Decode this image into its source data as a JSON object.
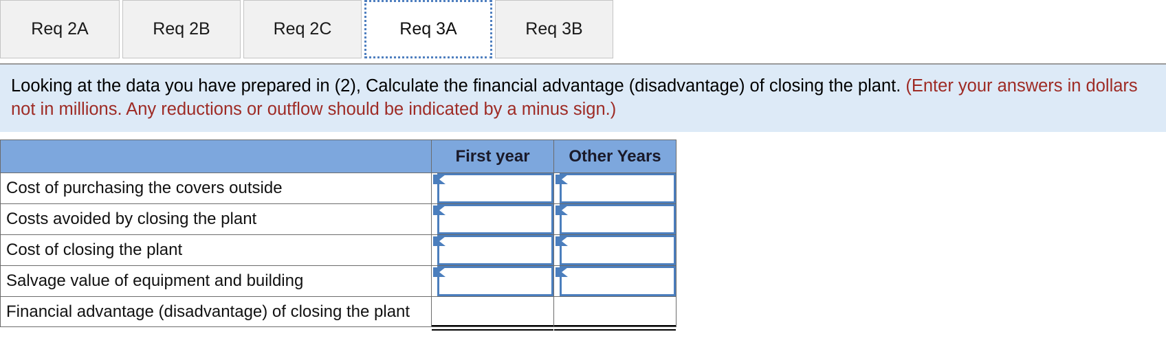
{
  "tabs": [
    {
      "label": "Req 2A",
      "active": false
    },
    {
      "label": "Req 2B",
      "active": false
    },
    {
      "label": "Req 2C",
      "active": false
    },
    {
      "label": "Req 3A",
      "active": true
    },
    {
      "label": "Req 3B",
      "active": false
    }
  ],
  "instructions": {
    "main": "Looking at the data you have prepared in (2), Calculate the financial advantage (disadvantage) of closing the plant.",
    "note": "(Enter your answers in dollars not in millions. Any reductions or outflow should be indicated by a minus sign.)"
  },
  "table": {
    "headers": {
      "label": "",
      "first_year": "First year",
      "other_years": "Other Years"
    },
    "rows": [
      {
        "label": "Cost of purchasing the covers outside",
        "first_year": "",
        "other_years": "",
        "type": "input"
      },
      {
        "label": "Costs avoided by closing the plant",
        "first_year": "",
        "other_years": "",
        "type": "input"
      },
      {
        "label": "Cost of closing the plant",
        "first_year": "",
        "other_years": "",
        "type": "input"
      },
      {
        "label": "Salvage value of equipment and building",
        "first_year": "",
        "other_years": "",
        "type": "input"
      },
      {
        "label": "Financial advantage (disadvantage) of closing the plant",
        "first_year": "",
        "other_years": "",
        "type": "total"
      }
    ]
  },
  "colors": {
    "header_blue": "#7da7dd",
    "panel_blue": "#ddeaf7",
    "note_red": "#9e2b25",
    "input_border": "#4b7ebd",
    "active_tab_border": "#4f7fbf"
  }
}
